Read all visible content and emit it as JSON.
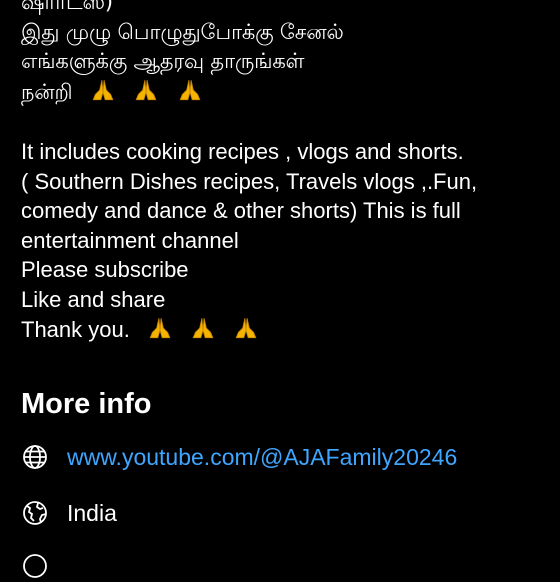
{
  "description": {
    "line1": "ஷார்ட்ஸ்)",
    "line2": "இது முழு பொழுதுபோக்கு சேனல்",
    "line3": "எங்களுக்கு ஆதரவு தாருங்கள்",
    "line4": "நன்றி",
    "line5": "It includes cooking recipes , vlogs and shorts.",
    "line6": "(  Southern Dishes recipes, Travels vlogs ,.Fun,",
    "line7": "comedy and dance & other shorts) This is full",
    "line8": "entertainment channel",
    "line9": "Please subscribe",
    "line10": "Like and share",
    "line11": "Thank you.",
    "emoji": "🙏",
    "emoji_color": "#f4b400"
  },
  "more_info": {
    "title": "More info",
    "link": {
      "icon": "globe-icon",
      "text": "www.youtube.com/@AJAFamily20246",
      "color": "#3ea6ff"
    },
    "country": {
      "icon": "earth-icon",
      "text": "India"
    },
    "next_row": {
      "icon": "info-icon"
    }
  },
  "colors": {
    "background": "#000000",
    "text": "#ffffff",
    "link": "#3ea6ff"
  }
}
